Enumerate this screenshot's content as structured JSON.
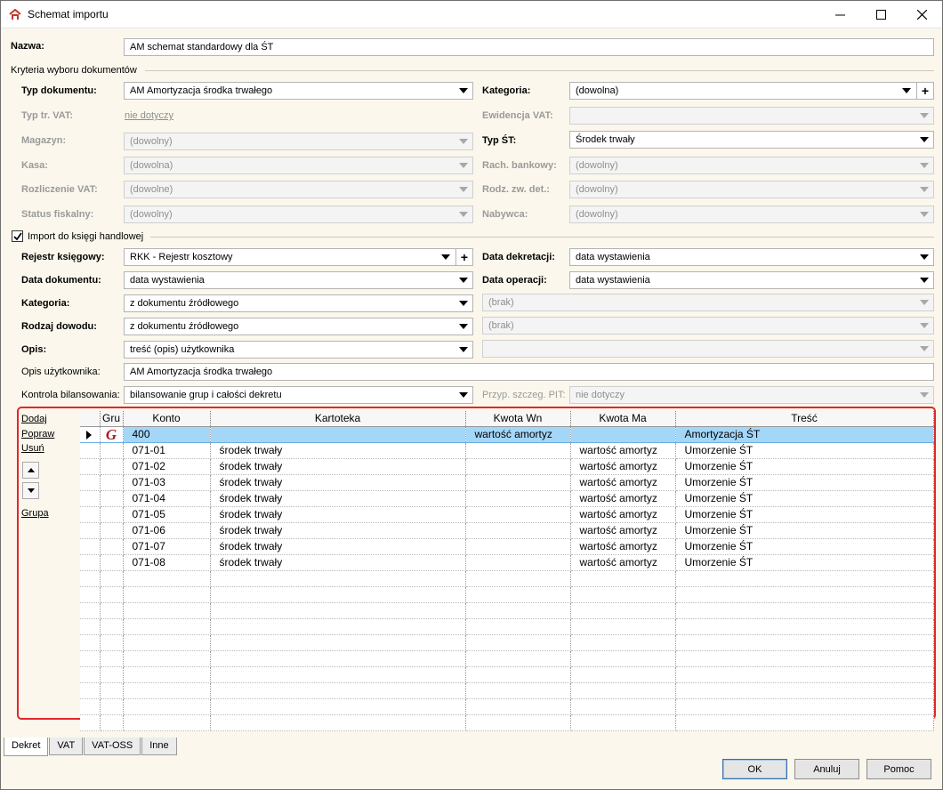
{
  "window": {
    "title": "Schemat importu"
  },
  "nazwa": {
    "label": "Nazwa:",
    "value": "AM schemat standardowy dla ŚT"
  },
  "kryteria": {
    "header": "Kryteria wyboru dokumentów",
    "typ_dokumentu": {
      "label": "Typ dokumentu:",
      "value": "AM Amortyzacja środka trwałego"
    },
    "kategoria": {
      "label": "Kategoria:",
      "value": "(dowolna)"
    },
    "typ_tr_vat": {
      "label": "Typ tr. VAT:",
      "value": "nie dotyczy"
    },
    "ewidencja_vat": {
      "label": "Ewidencja VAT:",
      "value": ""
    },
    "magazyn": {
      "label": "Magazyn:",
      "value": "(dowolny)"
    },
    "typ_st": {
      "label": "Typ ŚT:",
      "value": "Środek trwały"
    },
    "kasa": {
      "label": "Kasa:",
      "value": "(dowolna)"
    },
    "rach_bankowy": {
      "label": "Rach. bankowy:",
      "value": "(dowolny)"
    },
    "rozliczenie_vat": {
      "label": "Rozliczenie VAT:",
      "value": "(dowolne)"
    },
    "rodz_zw_det": {
      "label": "Rodz. zw. det.:",
      "value": "(dowolny)"
    },
    "status_fiskalny": {
      "label": "Status fiskalny:",
      "value": "(dowolny)"
    },
    "nabywca": {
      "label": "Nabywca:",
      "value": "(dowolny)"
    }
  },
  "import": {
    "checkbox_label": "Import do księgi handlowej",
    "checked": true,
    "rejestr": {
      "label": "Rejestr księgowy:",
      "value": "RKK - Rejestr kosztowy"
    },
    "data_dekretacji": {
      "label": "Data dekretacji:",
      "value": "data wystawienia"
    },
    "data_dokumentu": {
      "label": "Data dokumentu:",
      "value": "data wystawienia"
    },
    "data_operacji": {
      "label": "Data operacji:",
      "value": "data wystawienia"
    },
    "kategoria": {
      "label": "Kategoria:",
      "value": "z dokumentu źródłowego"
    },
    "kategoria_right": {
      "value": "(brak)"
    },
    "rodzaj_dowodu": {
      "label": "Rodzaj dowodu:",
      "value": "z dokumentu źródłowego"
    },
    "rodzaj_dowodu_right": {
      "value": "(brak)"
    },
    "opis": {
      "label": "Opis:",
      "value": "treść (opis) użytkownika"
    },
    "opis_right": {
      "value": ""
    },
    "opis_uzytkownika": {
      "label": "Opis użytkownika:",
      "value": "AM Amortyzacja środka trwałego"
    },
    "kontrola": {
      "label": "Kontrola bilansowania:",
      "value": "bilansowanie grup i całości dekretu"
    },
    "przyp_pit": {
      "label": "Przyp. szczeg. PIT:",
      "value": "nie dotyczy"
    }
  },
  "grid": {
    "side_links": {
      "dodaj": "Dodaj",
      "popraw": "Popraw",
      "usun": "Usuń",
      "grupa": "Grupa"
    },
    "columns": [
      "Gru",
      "Konto",
      "Kartoteka",
      "Kwota Wn",
      "Kwota Ma",
      "Treść"
    ],
    "rows": [
      {
        "konto": "400",
        "kartoteka": "",
        "kwota_wn": "wartość amortyz",
        "kwota_ma": "",
        "tresc": "Amortyzacja ŚT"
      },
      {
        "konto": "071-01",
        "kartoteka": "środek trwały",
        "kwota_wn": "",
        "kwota_ma": "wartość amortyz",
        "tresc": "Umorzenie ŚT"
      },
      {
        "konto": "071-02",
        "kartoteka": "środek trwały",
        "kwota_wn": "",
        "kwota_ma": "wartość amortyz",
        "tresc": "Umorzenie ŚT"
      },
      {
        "konto": "071-03",
        "kartoteka": "środek trwały",
        "kwota_wn": "",
        "kwota_ma": "wartość amortyz",
        "tresc": "Umorzenie ŚT"
      },
      {
        "konto": "071-04",
        "kartoteka": "środek trwały",
        "kwota_wn": "",
        "kwota_ma": "wartość amortyz",
        "tresc": "Umorzenie ŚT"
      },
      {
        "konto": "071-05",
        "kartoteka": "środek trwały",
        "kwota_wn": "",
        "kwota_ma": "wartość amortyz",
        "tresc": "Umorzenie ŚT"
      },
      {
        "konto": "071-06",
        "kartoteka": "środek trwały",
        "kwota_wn": "",
        "kwota_ma": "wartość amortyz",
        "tresc": "Umorzenie ŚT"
      },
      {
        "konto": "071-07",
        "kartoteka": "środek trwały",
        "kwota_wn": "",
        "kwota_ma": "wartość amortyz",
        "tresc": "Umorzenie ŚT"
      },
      {
        "konto": "071-08",
        "kartoteka": "środek trwały",
        "kwota_wn": "",
        "kwota_ma": "wartość amortyz",
        "tresc": "Umorzenie ŚT"
      }
    ]
  },
  "tabs": [
    "Dekret",
    "VAT",
    "VAT-OSS",
    "Inne"
  ],
  "buttons": {
    "ok": "OK",
    "anuluj": "Anuluj",
    "pomoc": "Pomoc"
  },
  "colors": {
    "accent_border": "#e2272b",
    "selected_row": "#a4d6f8",
    "panel_bg": "#fbf7ec"
  }
}
